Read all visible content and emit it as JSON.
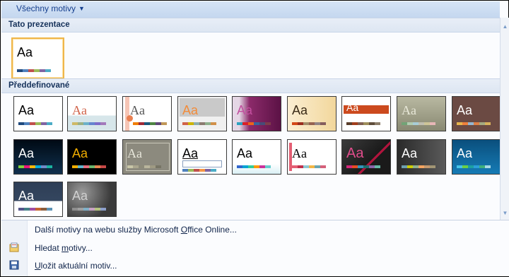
{
  "header": {
    "title": "Všechny motivy"
  },
  "sections": {
    "current": "Tato prezentace",
    "predefined": "Předdefinované"
  },
  "thumb_text": "Aa",
  "menu": {
    "more_online_pre": "Další motivy na webu služby Microsoft ",
    "more_online_u": "O",
    "more_online_post": "ffice Online...",
    "browse_pre": "Hledat ",
    "browse_u": "m",
    "browse_post": "otivy...",
    "save_u": "U",
    "save_post": "ložit aktuální motiv..."
  }
}
